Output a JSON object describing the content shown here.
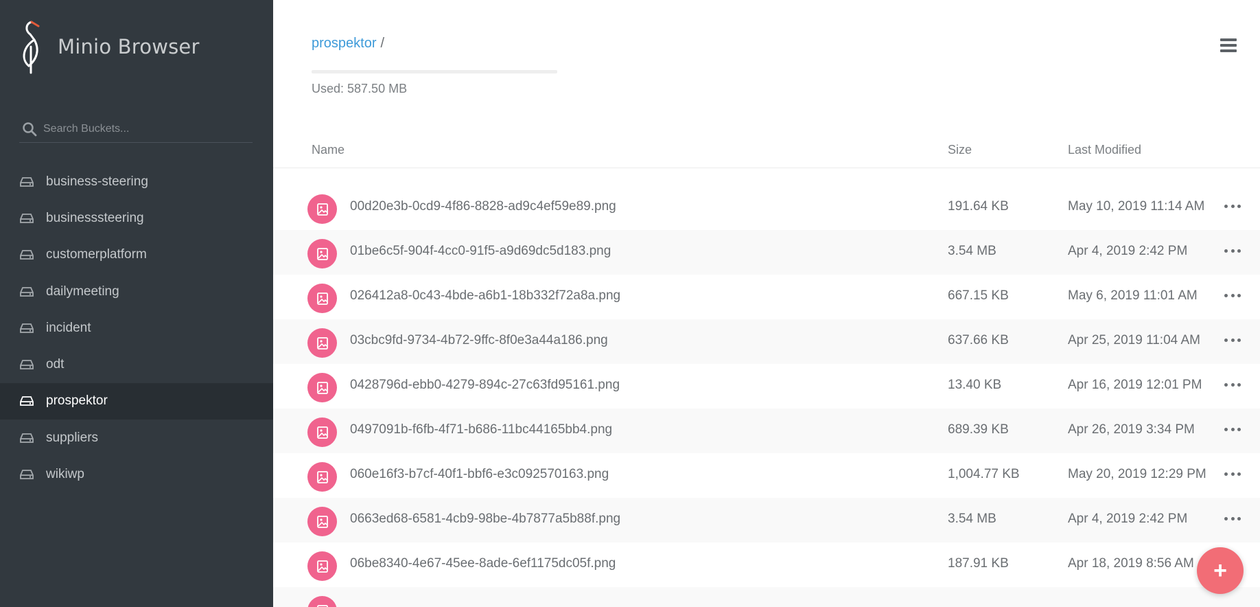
{
  "app": {
    "title": "Minio Browser"
  },
  "colors": {
    "sidebar_bg": "#32393f",
    "accent": "#3d9ad9",
    "file_icon": "#f0638e",
    "fab": "#f26d76"
  },
  "search": {
    "placeholder": "Search Buckets..."
  },
  "sidebar": {
    "buckets": [
      {
        "label": "business-steering",
        "icon": "disk-icon"
      },
      {
        "label": "businesssteering",
        "icon": "disk-icon"
      },
      {
        "label": "customerplatform",
        "icon": "disk-icon"
      },
      {
        "label": "dailymeeting",
        "icon": "disk-icon"
      },
      {
        "label": "incident",
        "icon": "disk-icon"
      },
      {
        "label": "odt",
        "icon": "disk-icon"
      },
      {
        "label": "prospektor",
        "icon": "disk-icon",
        "active": true
      },
      {
        "label": "suppliers",
        "icon": "disk-icon"
      },
      {
        "label": "wikiwp",
        "icon": "disk-icon"
      }
    ]
  },
  "header": {
    "breadcrumb": "prospektor",
    "separator": "/",
    "used_text": "Used: 587.50 MB",
    "menu_icon": "hamburger-icon"
  },
  "table": {
    "columns": {
      "name": "Name",
      "size": "Size",
      "modified": "Last Modified"
    },
    "rows": [
      {
        "name": "00d20e3b-0cd9-4f86-8828-ad9c4ef59e89.png",
        "size": "191.64 KB",
        "modified": "May 10, 2019 11:14 AM"
      },
      {
        "name": "01be6c5f-904f-4cc0-91f5-a9d69dc5d183.png",
        "size": "3.54 MB",
        "modified": "Apr 4, 2019 2:42 PM"
      },
      {
        "name": "026412a8-0c43-4bde-a6b1-18b332f72a8a.png",
        "size": "667.15 KB",
        "modified": "May 6, 2019 11:01 AM"
      },
      {
        "name": "03cbc9fd-9734-4b72-9ffc-8f0e3a44a186.png",
        "size": "637.66 KB",
        "modified": "Apr 25, 2019 11:04 AM"
      },
      {
        "name": "0428796d-ebb0-4279-894c-27c63fd95161.png",
        "size": "13.40 KB",
        "modified": "Apr 16, 2019 12:01 PM"
      },
      {
        "name": "0497091b-f6fb-4f71-b686-11bc44165bb4.png",
        "size": "689.39 KB",
        "modified": "Apr 26, 2019 3:34 PM"
      },
      {
        "name": "060e16f3-b7cf-40f1-bbf6-e3c092570163.png",
        "size": "1,004.77 KB",
        "modified": "May 20, 2019 12:29 PM"
      },
      {
        "name": "0663ed68-6581-4cb9-98be-4b7877a5b88f.png",
        "size": "3.54 MB",
        "modified": "Apr 4, 2019 2:42 PM"
      },
      {
        "name": "06be8340-4e67-45ee-8ade-6ef1175dc05f.png",
        "size": "187.91 KB",
        "modified": "Apr 18, 2019 8:56 AM"
      }
    ]
  },
  "fab": {
    "label": "+"
  }
}
